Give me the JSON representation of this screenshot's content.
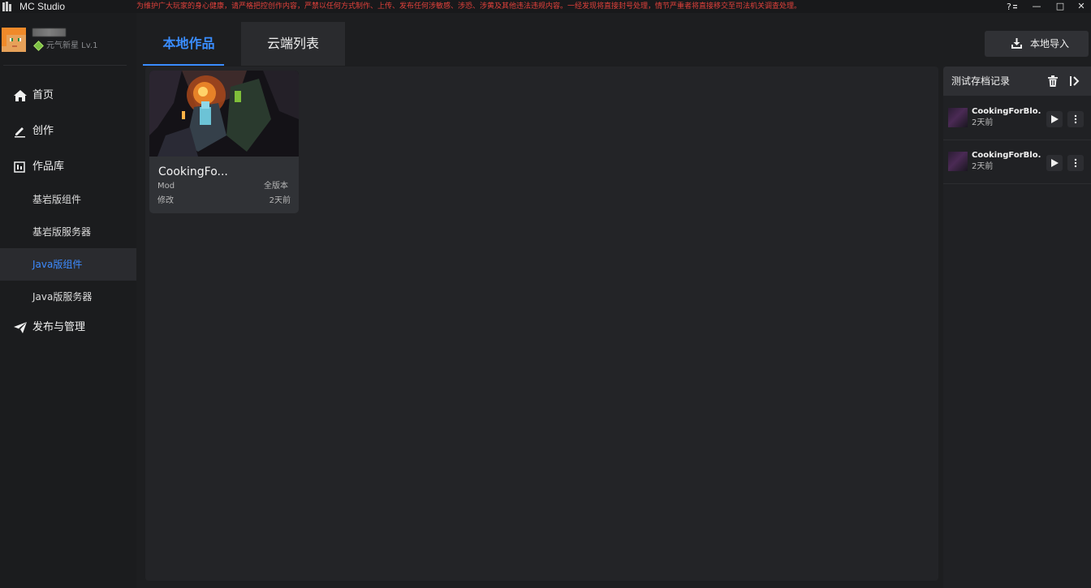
{
  "titlebar": {
    "app_title": "MC Studio",
    "notice": "为维护广大玩家的身心健康，请严格把控创作内容，严禁以任何方式制作、上传、发布任何涉敏感、涉恐、涉黄及其他违法违规内容。一经发现将直接封号处理，情节严重者将直接移交至司法机关调查处理。",
    "notice_color": "#e0413b",
    "help_icon": "help-settings-icon",
    "minimize_glyph": "—",
    "maximize_glyph": "□",
    "close_glyph": "✕"
  },
  "user": {
    "level": "元气新星 Lv.1"
  },
  "sidebar": {
    "items": [
      {
        "label": "首页",
        "icon": "home-icon"
      },
      {
        "label": "创作",
        "icon": "pen-icon"
      },
      {
        "label": "作品库",
        "icon": "library-icon"
      },
      {
        "label": "基岩版组件"
      },
      {
        "label": "基岩版服务器"
      },
      {
        "label": "Java版组件",
        "active": true
      },
      {
        "label": "Java版服务器"
      },
      {
        "label": "发布与管理",
        "icon": "paper-plane-icon"
      }
    ]
  },
  "tabs": {
    "local": "本地作品",
    "cloud": "云端列表"
  },
  "toolbar": {
    "import_label": "本地导入"
  },
  "card": {
    "name": "CookingFo...",
    "type": "Mod",
    "version": "全版本",
    "action": "修改",
    "time": "2天前"
  },
  "records": {
    "title": "测试存档记录",
    "items": [
      {
        "name": "CookingForBlo...",
        "time": "2天前"
      },
      {
        "name": "CookingForBlo...",
        "time": "2天前"
      }
    ]
  },
  "colors": {
    "accent": "#3a8dff",
    "background": "#1d1e20",
    "panel": "#232427"
  }
}
